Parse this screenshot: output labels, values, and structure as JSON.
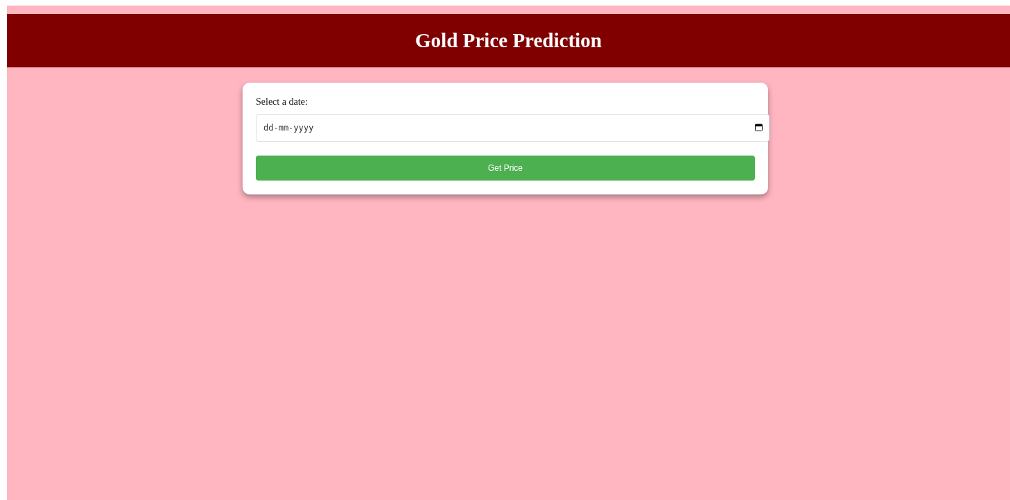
{
  "header": {
    "title": "Gold Price Prediction"
  },
  "form": {
    "label": "Select a date:",
    "date_field": {
      "placeholder": "dd-mm-yyyy"
    },
    "button": "Get Price"
  }
}
